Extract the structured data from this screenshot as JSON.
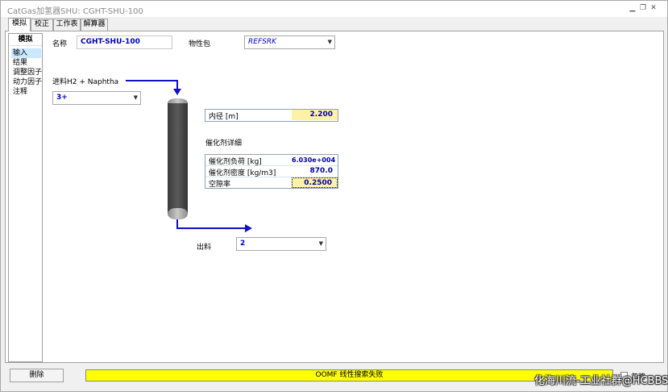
{
  "window": {
    "title": "CatGas加氢器SHU: CGHT-SHU-100",
    "controls": [
      "minimize-icon",
      "restore-icon",
      "close-icon"
    ]
  },
  "tabs": [
    {
      "label": "模拟",
      "active": true
    },
    {
      "label": "校正",
      "active": false
    },
    {
      "label": "工作表",
      "active": false
    },
    {
      "label": "解算器",
      "active": false
    }
  ],
  "nav": {
    "header": "模拟",
    "items": [
      {
        "label": "输入",
        "selected": true
      },
      {
        "label": "结果",
        "selected": false
      },
      {
        "label": "调整因子",
        "selected": false
      },
      {
        "label": "动力因子",
        "selected": false
      },
      {
        "label": "注释",
        "selected": false
      }
    ]
  },
  "form": {
    "name_label": "名称",
    "name_value": "CGHT-SHU-100",
    "property_package_label": "物性包",
    "property_package_value": "REFSRK",
    "feed_label": "进料H2 + Naphtha",
    "feed_value": "3+",
    "product_label": "出料",
    "product_value": "2"
  },
  "dimensions": {
    "rows": [
      {
        "label": "内径 [m]",
        "value": "2.200",
        "highlight": true
      }
    ]
  },
  "catalyst": {
    "section_label": "催化剂详细",
    "rows": [
      {
        "label": "催化剂负荷 [kg]",
        "value": "6.030e+004"
      },
      {
        "label": "催化剂密度 [kg/m3]",
        "value": "870.0"
      },
      {
        "label": "空隙率",
        "value": "0.2500"
      }
    ]
  },
  "footer": {
    "delete_label": "删除",
    "status_text": "OOMF 线性搜索失败",
    "ignore_label": "忽略",
    "watermark": "化海川流-工业社群@HCBBS"
  },
  "colors": {
    "value_text": "#0000c0",
    "highlight_cell": "#fff2a8",
    "status_bar": "#ffff00",
    "stream_arrow": "#1010c8",
    "column_body": "#4a4a4a"
  }
}
